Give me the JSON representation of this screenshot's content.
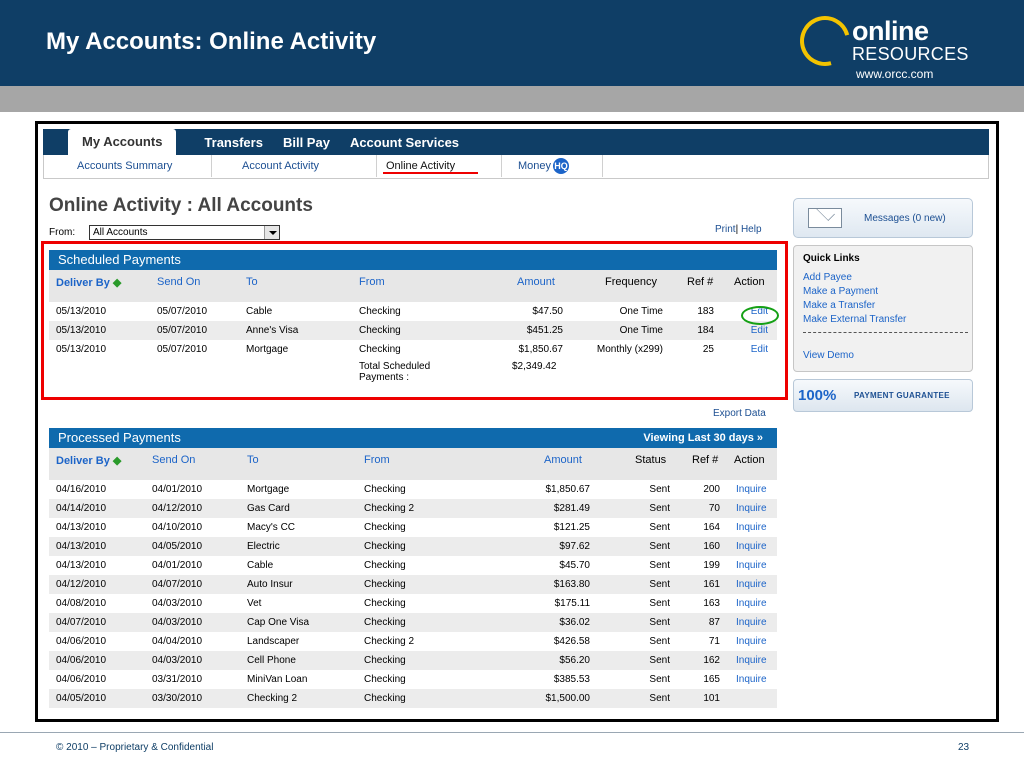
{
  "slide": {
    "title": "My Accounts: Online Activity",
    "logo_top": "online",
    "logo_bottom": "RESOURCES",
    "logo_url": "www.orcc.com",
    "footer": "© 2010 – Proprietary & Confidential",
    "page_number": "23"
  },
  "nav": {
    "tabs": [
      {
        "label": "My Accounts",
        "active": true
      },
      {
        "label": "Transfers"
      },
      {
        "label": "Bill Pay"
      },
      {
        "label": "Account Services"
      }
    ],
    "subtabs": [
      {
        "label": "Accounts Summary"
      },
      {
        "label": "Account Activity"
      },
      {
        "label": "Online Activity",
        "active": true
      },
      {
        "label": "Money",
        "icon": "money-hq-icon",
        "icon_text": "HQ"
      }
    ]
  },
  "page": {
    "title": "Online Activity : All Accounts",
    "from_label": "From:",
    "from_value": "All Accounts",
    "print": "Print",
    "link_sep": "|",
    "help": "Help",
    "export": "Export Data"
  },
  "scheduled": {
    "title": "Scheduled Payments",
    "columns": [
      "Deliver By",
      "Send On",
      "To",
      "From",
      "Amount",
      "Frequency",
      "Ref #",
      "Action"
    ],
    "rows": [
      {
        "deliver_by": "05/13/2010",
        "send_on": "05/07/2010",
        "to": "Cable",
        "from": "Checking",
        "amount": "$47.50",
        "frequency": "One Time",
        "ref": "183",
        "action": "Edit"
      },
      {
        "deliver_by": "05/13/2010",
        "send_on": "05/07/2010",
        "to": "Anne's Visa",
        "from": "Checking",
        "amount": "$451.25",
        "frequency": "One Time",
        "ref": "184",
        "action": "Edit"
      },
      {
        "deliver_by": "05/13/2010",
        "send_on": "05/07/2010",
        "to": "Mortgage",
        "from": "Checking",
        "amount": "$1,850.67",
        "frequency": "Monthly (x299)",
        "ref": "25",
        "action": "Edit"
      }
    ],
    "total_label_1": "Total Scheduled",
    "total_label_2": "Payments :",
    "total_amount": "$2,349.42"
  },
  "processed": {
    "title": "Processed Payments",
    "viewing": "Viewing Last 30 days »",
    "columns": [
      "Deliver By",
      "Send On",
      "To",
      "From",
      "Amount",
      "Status",
      "Ref #",
      "Action"
    ],
    "rows": [
      {
        "deliver_by": "04/16/2010",
        "send_on": "04/01/2010",
        "to": "Mortgage",
        "from": "Checking",
        "amount": "$1,850.67",
        "status": "Sent",
        "ref": "200",
        "action": "Inquire"
      },
      {
        "deliver_by": "04/14/2010",
        "send_on": "04/12/2010",
        "to": "Gas Card",
        "from": "Checking 2",
        "amount": "$281.49",
        "status": "Sent",
        "ref": "70",
        "action": "Inquire"
      },
      {
        "deliver_by": "04/13/2010",
        "send_on": "04/10/2010",
        "to": "Macy's CC",
        "from": "Checking",
        "amount": "$121.25",
        "status": "Sent",
        "ref": "164",
        "action": "Inquire"
      },
      {
        "deliver_by": "04/13/2010",
        "send_on": "04/05/2010",
        "to": "Electric",
        "from": "Checking",
        "amount": "$97.62",
        "status": "Sent",
        "ref": "160",
        "action": "Inquire"
      },
      {
        "deliver_by": "04/13/2010",
        "send_on": "04/01/2010",
        "to": "Cable",
        "from": "Checking",
        "amount": "$45.70",
        "status": "Sent",
        "ref": "199",
        "action": "Inquire"
      },
      {
        "deliver_by": "04/12/2010",
        "send_on": "04/07/2010",
        "to": "Auto Insur",
        "from": "Checking",
        "amount": "$163.80",
        "status": "Sent",
        "ref": "161",
        "action": "Inquire"
      },
      {
        "deliver_by": "04/08/2010",
        "send_on": "04/03/2010",
        "to": "Vet",
        "from": "Checking",
        "amount": "$175.11",
        "status": "Sent",
        "ref": "163",
        "action": "Inquire"
      },
      {
        "deliver_by": "04/07/2010",
        "send_on": "04/03/2010",
        "to": "Cap One Visa",
        "from": "Checking",
        "amount": "$36.02",
        "status": "Sent",
        "ref": "87",
        "action": "Inquire"
      },
      {
        "deliver_by": "04/06/2010",
        "send_on": "04/04/2010",
        "to": "Landscaper",
        "from": "Checking 2",
        "amount": "$426.58",
        "status": "Sent",
        "ref": "71",
        "action": "Inquire"
      },
      {
        "deliver_by": "04/06/2010",
        "send_on": "04/03/2010",
        "to": "Cell Phone",
        "from": "Checking",
        "amount": "$56.20",
        "status": "Sent",
        "ref": "162",
        "action": "Inquire"
      },
      {
        "deliver_by": "04/06/2010",
        "send_on": "03/31/2010",
        "to": "MiniVan Loan",
        "from": "Checking",
        "amount": "$385.53",
        "status": "Sent",
        "ref": "165",
        "action": "Inquire"
      },
      {
        "deliver_by": "04/05/2010",
        "send_on": "03/30/2010",
        "to": "Checking 2",
        "from": "Checking",
        "amount": "$1,500.00",
        "status": "Sent",
        "ref": "101",
        "action": ""
      }
    ]
  },
  "sidebar": {
    "messages": "Messages (0 new)",
    "quick_links_title": "Quick Links",
    "quick_links": [
      "Add Payee",
      "Make a Payment",
      "Make a Transfer",
      "Make External Transfer"
    ],
    "view_demo": "View Demo",
    "guarantee_pct": "100%",
    "guarantee_text": "PAYMENT GUARANTEE"
  }
}
